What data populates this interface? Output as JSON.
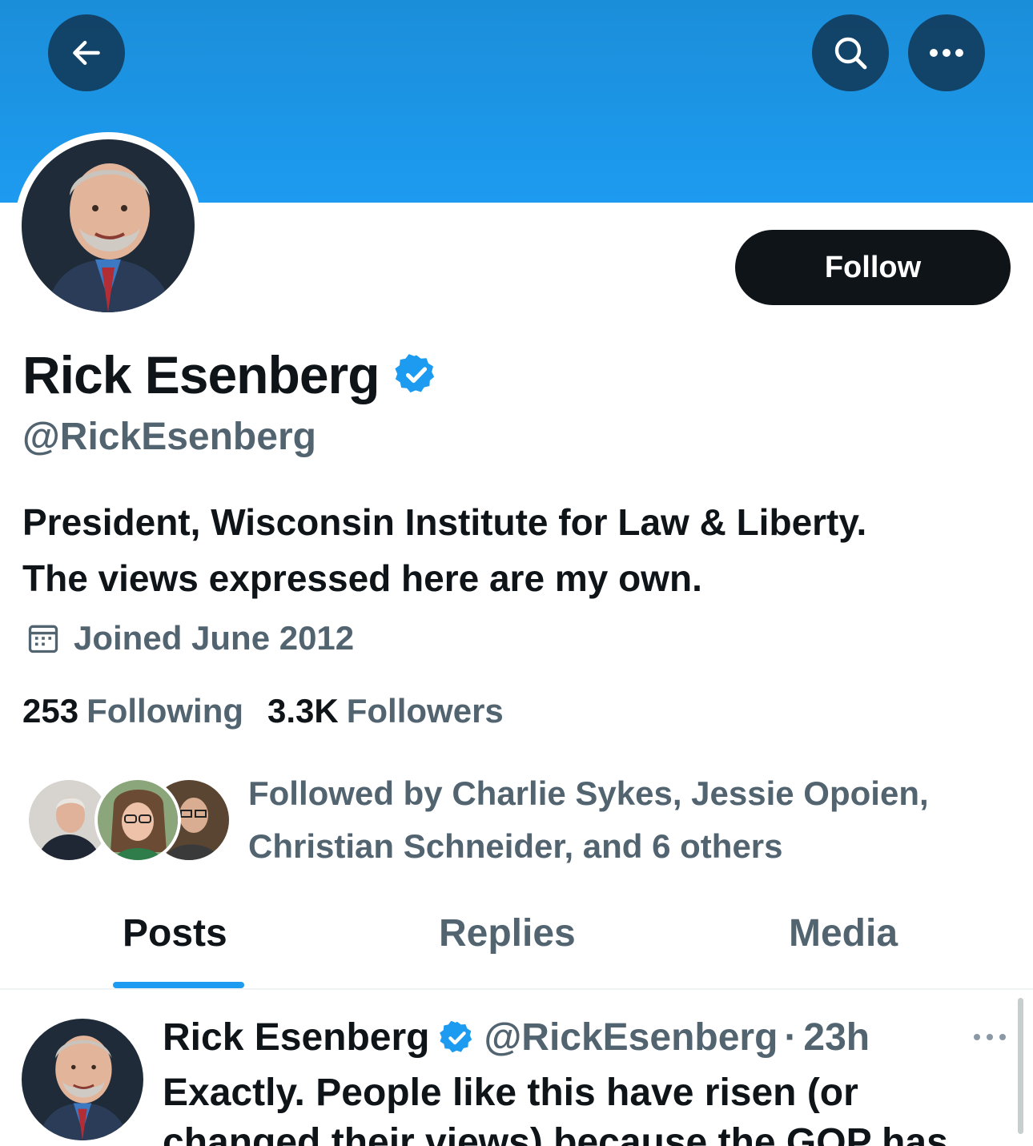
{
  "header": {
    "back_icon": "arrow-left-icon",
    "search_icon": "search-icon",
    "more_icon": "more-horizontal-icon",
    "banner_color": "#1d9bf0"
  },
  "profile": {
    "follow_label": "Follow",
    "display_name": "Rick Esenberg",
    "verified_icon": "verified-badge-icon",
    "handle": "@RickEsenberg",
    "bio_line1": "President, Wisconsin Institute for Law & Liberty.",
    "bio_line2": "The views expressed here are my own.",
    "joined_icon": "calendar-icon",
    "joined": "Joined June 2012",
    "following_count": "253",
    "following_label": "Following",
    "followers_count": "3.3K",
    "followers_label": "Followers",
    "followed_by_line1": "Followed by Charlie Sykes, Jessie Opoien,",
    "followed_by_line2": "Christian Schneider, and 6 others"
  },
  "tabs": [
    {
      "label": "Posts",
      "active": true
    },
    {
      "label": "Replies",
      "active": false
    },
    {
      "label": "Media",
      "active": false
    }
  ],
  "post": {
    "name": "Rick Esenberg",
    "handle": "@RickEsenberg",
    "separator": "·",
    "time": "23h",
    "text_line1": "Exactly. People like this have risen (or",
    "text_line2": "changed their views) because the GOP has"
  },
  "colors": {
    "accent": "#1d9bf0",
    "text_primary": "#0f1419",
    "text_secondary": "#536471"
  }
}
